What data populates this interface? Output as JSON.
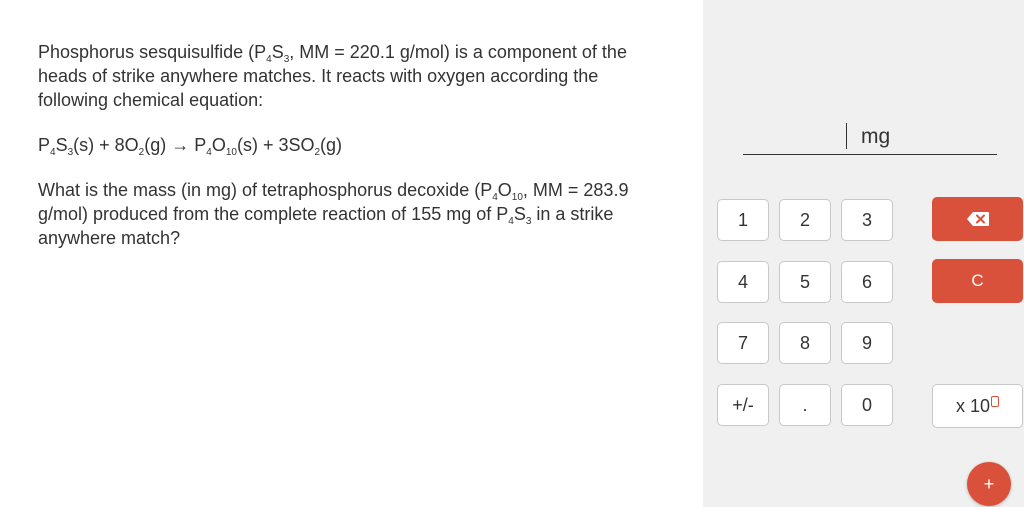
{
  "question": {
    "p1": [
      "Phosphorus sesquisulfide (P",
      "4",
      "S",
      "3",
      ", MM = 220.1 g/mol) is a component of the heads of strike anywhere matches. It reacts with oxygen according the following chemical equation:"
    ],
    "equation": [
      "P",
      "4",
      "S",
      "3",
      "(s) + 8O",
      "2",
      "(g) → P",
      "4",
      "O",
      "10",
      "(s) + 3SO",
      "2",
      "(g)"
    ],
    "p3": [
      "What is the mass (in mg) of tetraphosphorus decoxide (P",
      "4",
      "O",
      "10",
      ", MM = 283.9 g/mol) produced from the complete reaction of 155 mg of P",
      "4",
      "S",
      "3",
      " in a strike anywhere match?"
    ]
  },
  "answer": {
    "value": "",
    "unit": "mg"
  },
  "keypad": {
    "keys": [
      "1",
      "2",
      "3",
      "4",
      "5",
      "6",
      "7",
      "8",
      "9",
      "+/-",
      ".",
      "0"
    ],
    "backspace_icon": "backspace-icon",
    "clear_label": "C",
    "exp_label": "x 10",
    "add_label": "+"
  },
  "colors": {
    "accent": "#d9503b",
    "panel": "#f0f0f0"
  }
}
